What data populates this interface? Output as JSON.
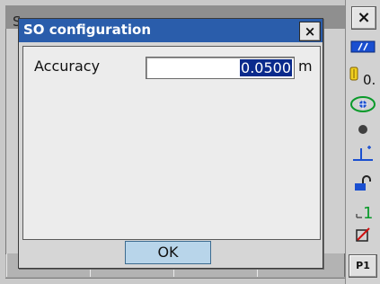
{
  "background": {
    "title_char": "S"
  },
  "dialog": {
    "title": "SO configuration",
    "close_label": "×",
    "accuracy_label": "Accuracy",
    "accuracy_value": "0.0500",
    "accuracy_unit": "m",
    "ok_label": "OK"
  },
  "side_panel": {
    "close_label": "×",
    "angle_label": "0.",
    "tilt_index": "1",
    "page_label": "P1",
    "icons": [
      "battery-icon",
      "prism-icon",
      "laser-pointer-icon",
      "dot-icon",
      "tribrach-icon",
      "prism-constant-icon",
      "tilt-icon",
      "edit-off-icon"
    ]
  },
  "colors": {
    "title_bar": "#2a5dab",
    "selection": "#0a2a8c",
    "ok_button": "#b8d5ea",
    "icon_blue": "#1a4fd0",
    "icon_green": "#0a9a2a"
  }
}
